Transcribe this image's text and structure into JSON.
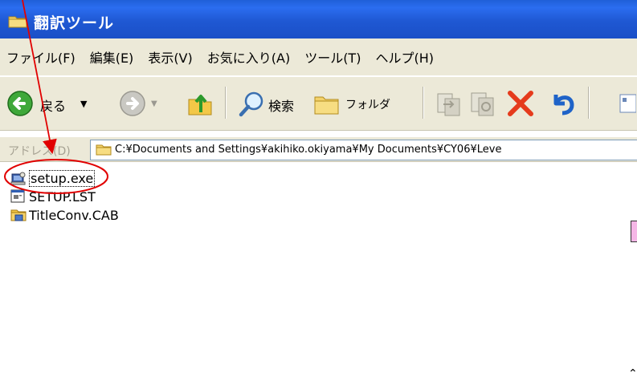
{
  "window": {
    "title": "翻訳ツール",
    "title_icon": "folder-icon"
  },
  "menu": [
    "ファイル(F)",
    "編集(E)",
    "表示(V)",
    "お気に入り(A)",
    "ツール(T)",
    "ヘルプ(H)"
  ],
  "toolbar": {
    "back_label": "戻る",
    "search_label": "検索",
    "folders_label": "フォルダ",
    "icons": [
      "back-arrow-icon",
      "forward-arrow-icon",
      "up-folder-icon",
      "search-icon",
      "folders-icon",
      "move-to-icon",
      "copy-to-icon",
      "delete-icon",
      "undo-icon"
    ]
  },
  "address": {
    "label": "アドレス(D)",
    "path": "C:¥Documents and Settings¥akihiko.okiyama¥My Documents¥CY06¥Leve"
  },
  "files": [
    {
      "name": "setup.exe",
      "icon": "installer-icon",
      "selected": true
    },
    {
      "name": "SETUP.LST",
      "icon": "list-file-icon",
      "selected": false
    },
    {
      "name": "TitleConv.CAB",
      "icon": "cabinet-file-icon",
      "selected": false
    }
  ],
  "colors": {
    "titlebar": "#1f58d3",
    "chrome": "#ece9d8",
    "annotation": "#e10000"
  }
}
